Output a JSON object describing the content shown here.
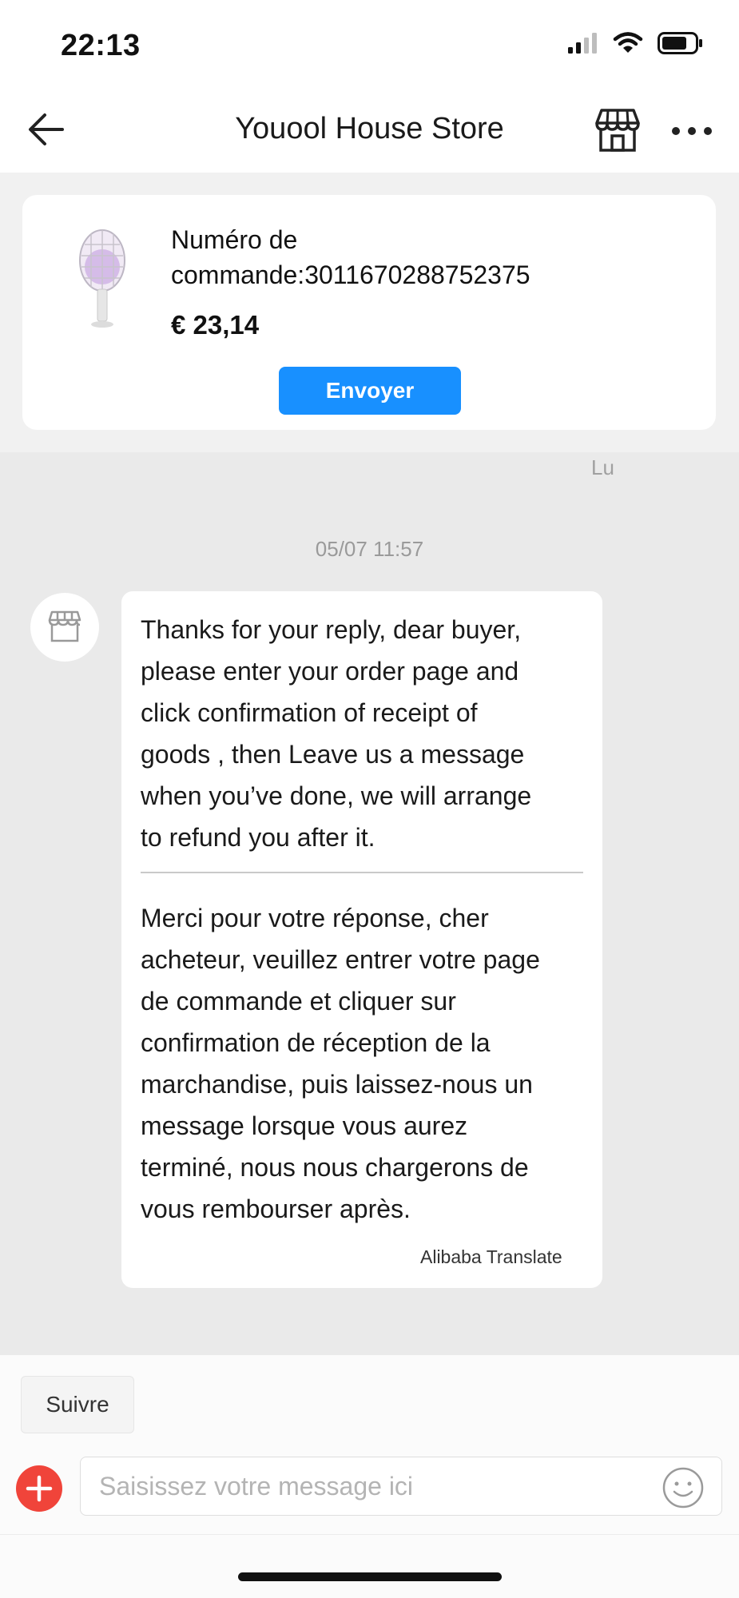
{
  "status_bar": {
    "time": "22:13"
  },
  "header": {
    "title": "Youool House Store"
  },
  "order_card": {
    "order_line_1": "Numéro de",
    "order_line_2": "commande:3011670288752375",
    "price": "€ 23,14",
    "send_label": "Envoyer"
  },
  "chat": {
    "read_status": "Lu",
    "timestamp": "05/07 11:57",
    "message": {
      "original_lines": [
        "Thanks for your reply, dear buyer,",
        "please enter your order page and",
        "click confirmation of receipt of",
        "goods , then Leave us a message",
        "when you’ve done, we will arrange",
        "to refund you after it."
      ],
      "translated_lines": [
        "Merci pour votre réponse, cher",
        "acheteur, veuillez entrer votre page",
        "de commande et cliquer sur",
        "confirmation de réception de la",
        "marchandise, puis laissez-nous un",
        "message lorsque vous aurez",
        "terminé, nous nous chargerons de",
        "vous rembourser après."
      ],
      "translation_credit": "Alibaba Translate"
    }
  },
  "footer": {
    "follow_label": "Suivre",
    "input_placeholder": "Saisissez votre message ici"
  },
  "colors": {
    "accent": "#1890ff",
    "add_button": "#f0443a"
  }
}
